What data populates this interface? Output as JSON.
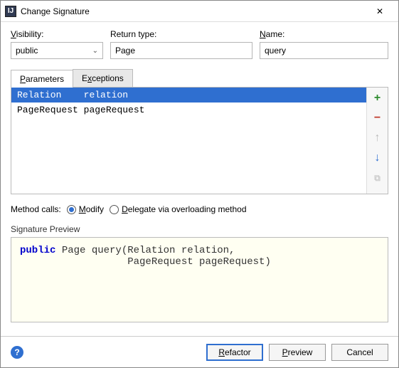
{
  "window": {
    "title": "Change Signature"
  },
  "labels": {
    "visibility": "Visibility:",
    "return_type": "Return type:",
    "name": "Name:",
    "method_calls": "Method calls:",
    "signature_preview": "Signature Preview"
  },
  "fields": {
    "visibility_value": "public",
    "return_type_value": "Page",
    "name_value": "query"
  },
  "tabs": {
    "parameters": "Parameters",
    "exceptions": "Exceptions",
    "active": "parameters"
  },
  "parameters": [
    {
      "type": "Relation",
      "name": "relation",
      "selected": true
    },
    {
      "type": "PageRequest",
      "name": "pageRequest",
      "selected": false
    }
  ],
  "radios": {
    "modify": "Modify",
    "delegate": "Delegate via overloading method",
    "selected": "modify"
  },
  "signature_preview": {
    "keyword": "public",
    "line1_rest": " Page query(Relation relation,",
    "line2": "                  PageRequest pageRequest)"
  },
  "buttons": {
    "refactor": "Refactor",
    "preview": "Preview",
    "cancel": "Cancel"
  },
  "icons": {
    "close": "✕",
    "add": "+",
    "remove": "−",
    "up": "↑",
    "down": "↓",
    "rule": "⧉",
    "help": "?",
    "chevron": "⌄"
  }
}
